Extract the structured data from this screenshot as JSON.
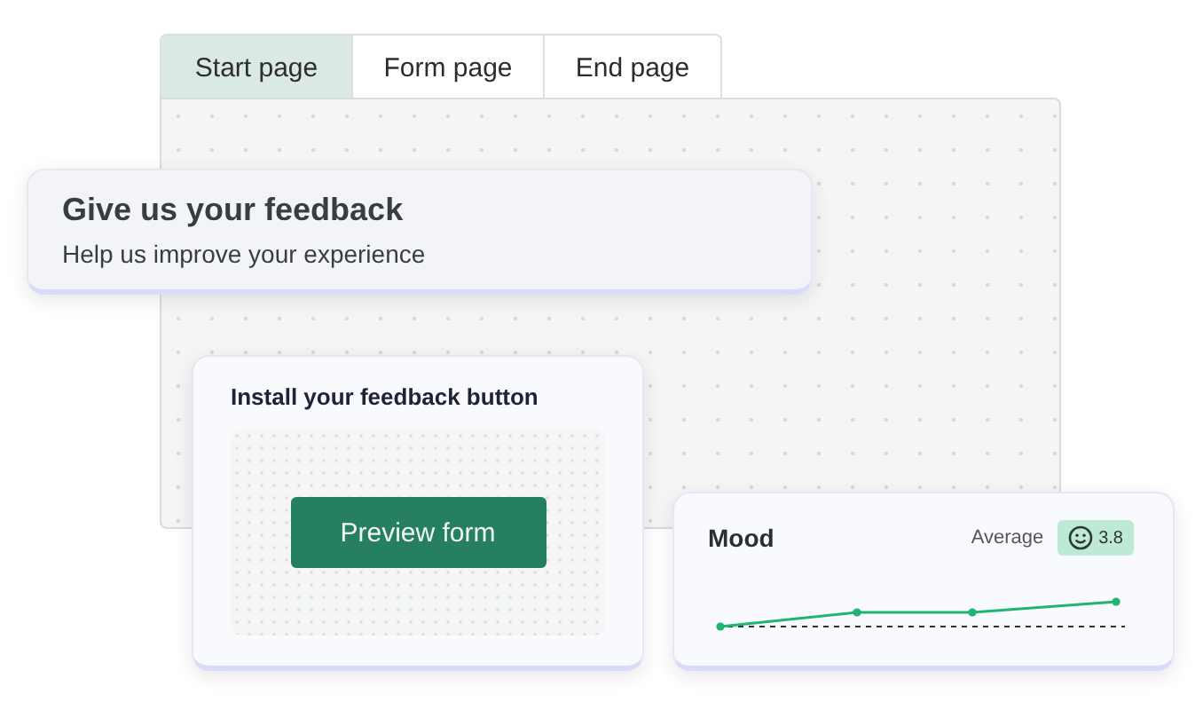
{
  "tabs": [
    {
      "label": "Start page",
      "selected": true
    },
    {
      "label": "Form page",
      "selected": false
    },
    {
      "label": "End page",
      "selected": false
    }
  ],
  "feedback_card": {
    "title": "Give us your feedback",
    "subtitle": "Help us improve your experience"
  },
  "install_card": {
    "title": "Install your feedback button",
    "button": "Preview form"
  },
  "mood_card": {
    "title": "Mood",
    "average_label": "Average",
    "average_value": "3.8"
  }
}
